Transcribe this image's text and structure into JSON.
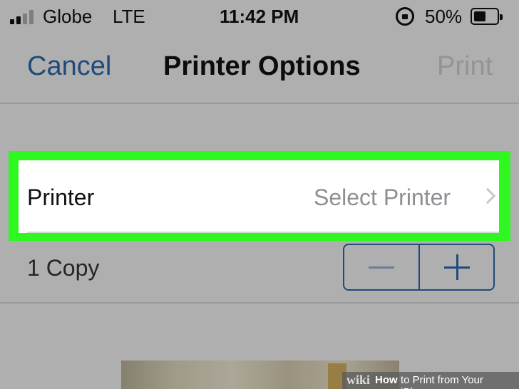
{
  "status_bar": {
    "carrier": "Globe",
    "network": "LTE",
    "time": "11:42 PM",
    "battery_percent": "50%",
    "battery_level": 0.5,
    "icons": [
      "signal-icon",
      "rotation-lock-icon",
      "battery-icon"
    ]
  },
  "nav": {
    "cancel_label": "Cancel",
    "title": "Printer Options",
    "print_label": "Print"
  },
  "printer_row": {
    "label": "Printer",
    "value": "Select Printer",
    "icon": "chevron-right-icon"
  },
  "copies_row": {
    "label": "1 Copy",
    "decrement_icon": "minus-icon",
    "increment_icon": "plus-icon"
  },
  "watermark": {
    "brand": "wiki",
    "how": "How",
    "rest": "to Print from Your iPhone"
  },
  "colors": {
    "accent": "#2b64a8",
    "highlight": "#2ef81f",
    "disabled": "#c8c8c8"
  }
}
